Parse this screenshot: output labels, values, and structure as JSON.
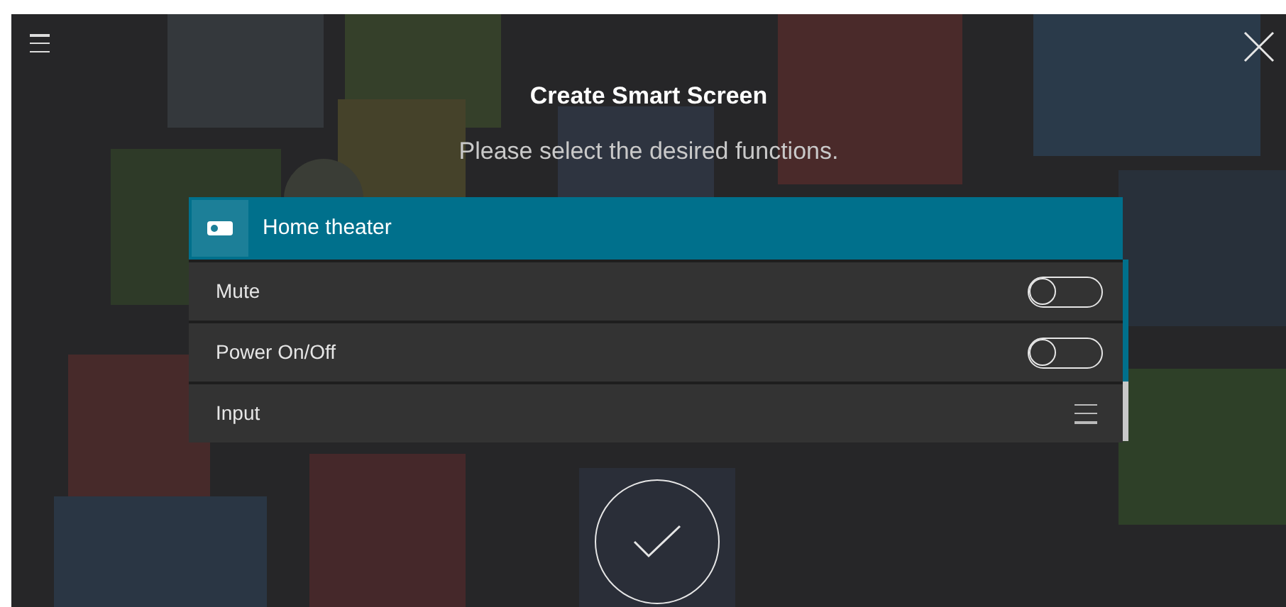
{
  "title": "Create Smart Screen",
  "subtitle": "Please select the desired functions.",
  "group": {
    "label": "Home theater",
    "expanded": true
  },
  "functions": [
    {
      "label": "Mute",
      "kind": "toggle",
      "on": false
    },
    {
      "label": "Power On/Off",
      "kind": "toggle",
      "on": false
    },
    {
      "label": "Input",
      "kind": "list"
    }
  ]
}
